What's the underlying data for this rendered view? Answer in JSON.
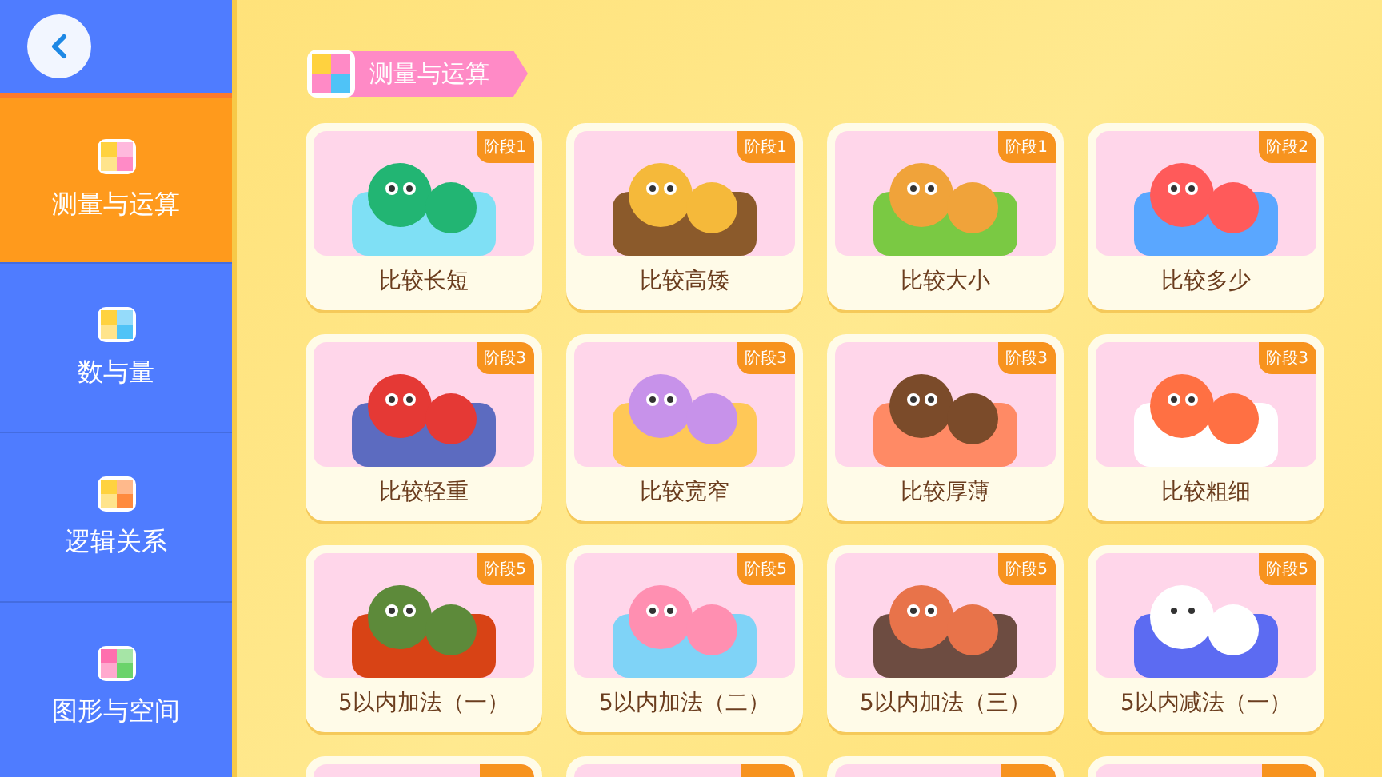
{
  "sidebar": {
    "items": [
      {
        "label": "测量与运算",
        "selected": true
      },
      {
        "label": "数与量",
        "selected": false
      },
      {
        "label": "逻辑关系",
        "selected": false
      },
      {
        "label": "图形与空间",
        "selected": false
      }
    ]
  },
  "section": {
    "title": "测量与运算"
  },
  "cards": [
    {
      "title": "比较长短",
      "badge": "阶段1"
    },
    {
      "title": "比较高矮",
      "badge": "阶段1"
    },
    {
      "title": "比较大小",
      "badge": "阶段1"
    },
    {
      "title": "比较多少",
      "badge": "阶段2"
    },
    {
      "title": "比较轻重",
      "badge": "阶段3"
    },
    {
      "title": "比较宽窄",
      "badge": "阶段3"
    },
    {
      "title": "比较厚薄",
      "badge": "阶段3"
    },
    {
      "title": "比较粗细",
      "badge": "阶段3"
    },
    {
      "title": "5以内加法（一）",
      "badge": "阶段5"
    },
    {
      "title": "5以内加法（二）",
      "badge": "阶段5"
    },
    {
      "title": "5以内加法（三）",
      "badge": "阶段5"
    },
    {
      "title": "5以内减法（一）",
      "badge": "阶段5"
    }
  ]
}
